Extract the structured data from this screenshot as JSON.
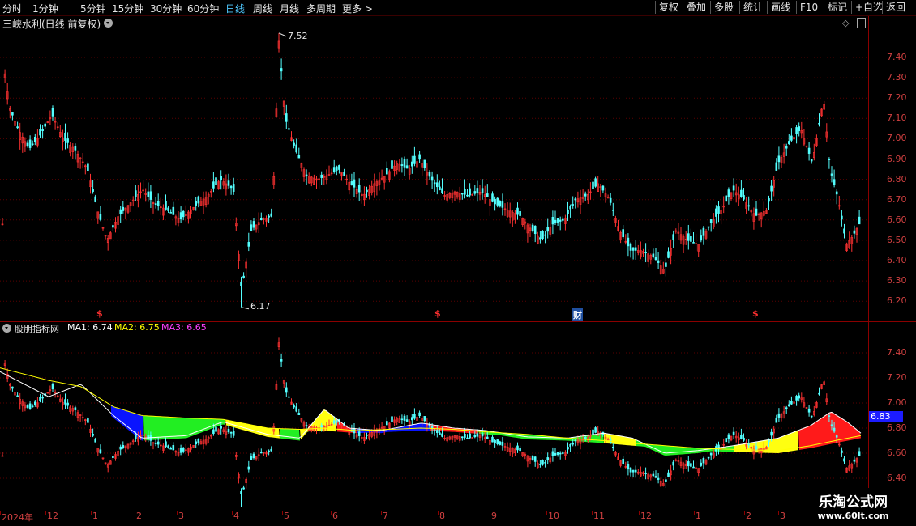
{
  "toolbar": {
    "periods": [
      "分时",
      "1分钟",
      "5分钟",
      "15分钟",
      "30分钟",
      "60分钟",
      "日线",
      "周线",
      "月线",
      "多周期",
      "更多"
    ],
    "active_period": "日线",
    "more_arrow": ">",
    "buttons": [
      "复权",
      "叠加",
      "多股",
      "统计",
      "画线",
      "F10",
      "标记",
      "+自选",
      "返回"
    ]
  },
  "main": {
    "title": "三峡水利(日线 前复权)",
    "high_label": "7.52",
    "low_label": "6.17",
    "y_ticks": [
      "7.40",
      "7.30",
      "7.20",
      "7.10",
      "7.00",
      "6.90",
      "6.80",
      "6.70",
      "6.60",
      "6.50",
      "6.40",
      "6.30",
      "6.20"
    ],
    "markers": [
      {
        "text": "$",
        "color": "#ff3030"
      },
      {
        "text": "$",
        "color": "#ff3030"
      },
      {
        "text": "财",
        "color": "#ffffff"
      },
      {
        "text": "$",
        "color": "#ff3030"
      }
    ]
  },
  "indicator": {
    "name": "股朋指标网",
    "ma": [
      {
        "label": "MA1:",
        "value": "6.74",
        "color": "#ffffff"
      },
      {
        "label": "MA2:",
        "value": "6.75",
        "color": "#ffff00"
      },
      {
        "label": "MA3:",
        "value": "6.65",
        "color": "#ff40ff"
      }
    ],
    "y_ticks": [
      "7.40",
      "7.20",
      "7.00",
      "6.80",
      "6.60",
      "6.40"
    ],
    "current_value": "6.83"
  },
  "x_axis": [
    "2024年",
    "12",
    "1",
    "2",
    "3",
    "4",
    "5",
    "6",
    "7",
    "8",
    "9",
    "10",
    "11",
    "12",
    "1",
    "2",
    "3"
  ],
  "watermark": {
    "line1": "乐淘公式网",
    "line2": "www.60lt.com"
  },
  "colors": {
    "up": "#ff3232",
    "down": "#54ffff",
    "grid": "#8b0000",
    "bg": "#000000"
  }
}
